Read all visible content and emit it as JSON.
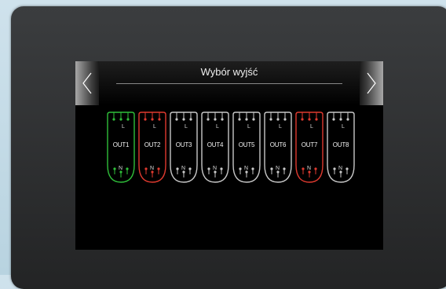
{
  "screen": {
    "title": "Wybór wyjść",
    "prev_icon": "chevron-left-icon",
    "next_icon": "chevron-right-icon"
  },
  "colors": {
    "active": "#2fbf3a",
    "error": "#e03a2f",
    "inactive": "#c8c8c8"
  },
  "outputs": [
    {
      "label": "OUT1",
      "top_terminal": "L",
      "bottom_terminal": "N",
      "state": "active"
    },
    {
      "label": "OUT2",
      "top_terminal": "L",
      "bottom_terminal": "N",
      "state": "error"
    },
    {
      "label": "OUT3",
      "top_terminal": "L",
      "bottom_terminal": "N",
      "state": "inactive"
    },
    {
      "label": "OUT4",
      "top_terminal": "L",
      "bottom_terminal": "N",
      "state": "inactive"
    },
    {
      "label": "OUT5",
      "top_terminal": "L",
      "bottom_terminal": "N",
      "state": "inactive"
    },
    {
      "label": "OUT6",
      "top_terminal": "L",
      "bottom_terminal": "N",
      "state": "inactive"
    },
    {
      "label": "OUT7",
      "top_terminal": "L",
      "bottom_terminal": "N",
      "state": "error"
    },
    {
      "label": "OUT8",
      "top_terminal": "L",
      "bottom_terminal": "N",
      "state": "inactive"
    }
  ]
}
